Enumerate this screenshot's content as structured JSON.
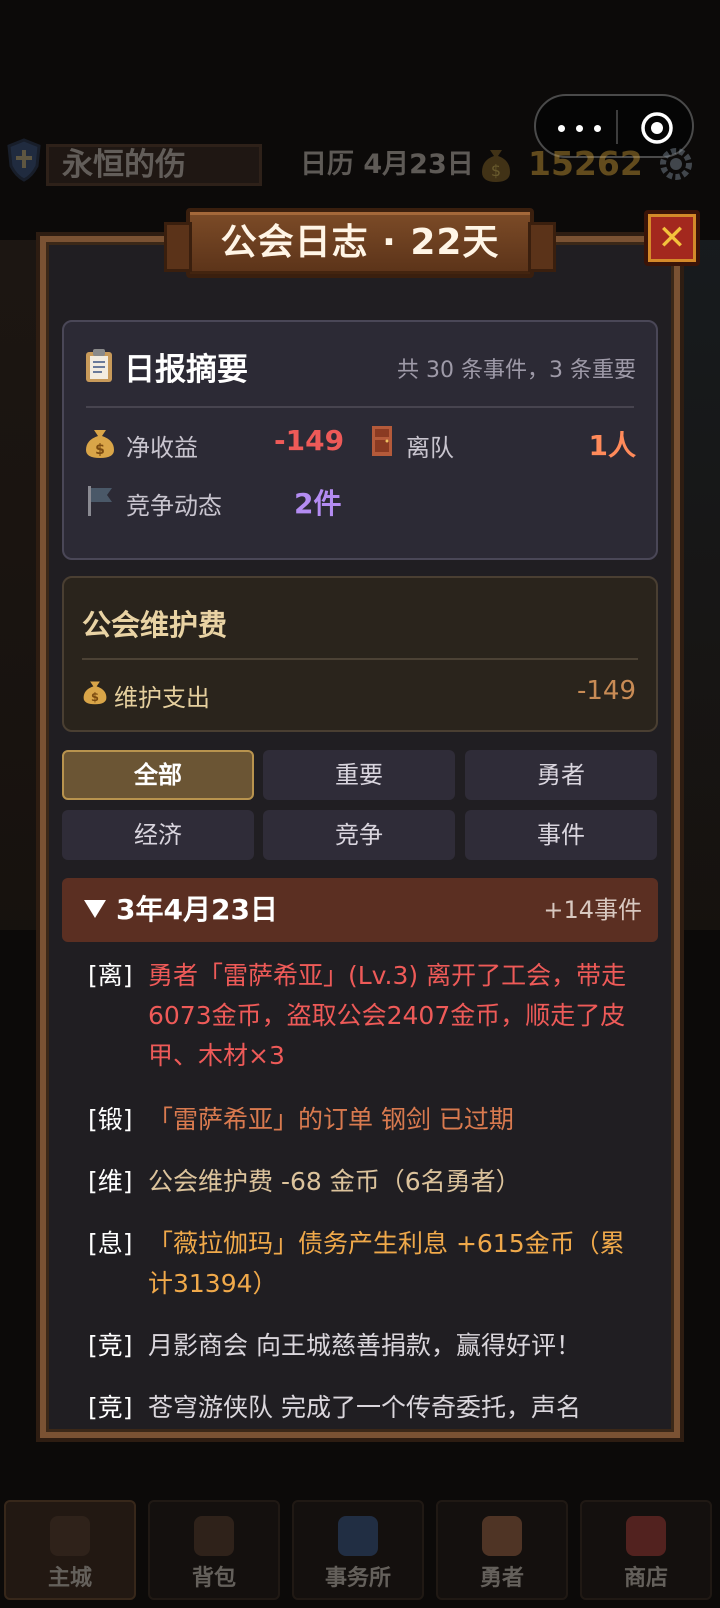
{
  "background": {
    "player_name": "永恒的伤",
    "calendar": "日历 4月23日",
    "gold": "15262",
    "tabs": [
      {
        "label": "主城"
      },
      {
        "label": "背包"
      },
      {
        "label": "事务所"
      },
      {
        "label": "勇者"
      },
      {
        "label": "商店"
      }
    ]
  },
  "modal": {
    "title": "公会日志 · 22天",
    "close_label": "✕"
  },
  "summary": {
    "title": "日报摘要",
    "subtitle": "共 30 条事件，3 条重要",
    "net_income_label": "净收益",
    "net_income_value": "-149",
    "leave_label": "离队",
    "leave_value": "1人",
    "competition_label": "竞争动态",
    "competition_value": "2件"
  },
  "maintenance": {
    "title": "公会维护费",
    "label": "维护支出",
    "value": "-149"
  },
  "filters": [
    "全部",
    "重要",
    "勇者",
    "经济",
    "竞争",
    "事件"
  ],
  "active_filter": "全部",
  "day": {
    "date": "3年4月23日",
    "count": "+14事件"
  },
  "logs": [
    {
      "tag": "[离]",
      "text": "勇者「雷萨希亚」(Lv.3) 离开了工会，带走6073金币，盗取公会2407金币，顺走了皮甲、木材×3",
      "color": "#ee5a58"
    },
    {
      "tag": "[锻]",
      "text": "「雷萨希亚」的订单 钢剑 已过期",
      "color": "#d97a4f"
    },
    {
      "tag": "[维]",
      "text": "公会维护费 -68 金币（6名勇者）",
      "color": "#dcc39c"
    },
    {
      "tag": "[息]",
      "text": "「薇拉伽玛」债务产生利息 +615金币（累计31394）",
      "color": "#f0a94a"
    },
    {
      "tag": "[竞]",
      "text": "月影商会 向王城慈善捐款，赢得好评！",
      "color": "#dad6dc"
    },
    {
      "tag": "[竞]",
      "text": "苍穹游侠队 完成了一个传奇委托，声名",
      "color": "#dad6dc"
    }
  ],
  "colors": {
    "accent_gold": "#b8934e",
    "negative": "#ee5a58",
    "leave": "#ff8a5a",
    "competition": "#b48cf2",
    "day_header": "#5b2f22"
  }
}
